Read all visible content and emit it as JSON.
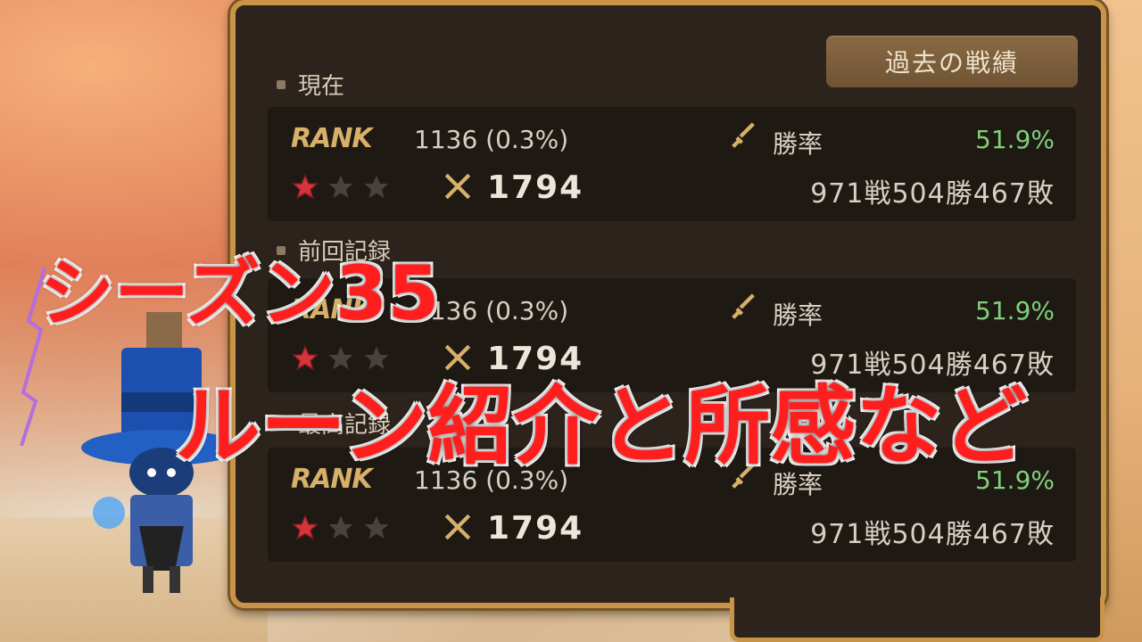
{
  "panel": {
    "history_button": "過去の戦績"
  },
  "sections": [
    {
      "label": "現在",
      "rank_label": "RANK",
      "rank_value": "1136 (0.3%)",
      "score": "1794",
      "winrate_label": "勝率",
      "winrate_value": "51.9%",
      "record": "971戦504勝467敗"
    },
    {
      "label": "前回記録",
      "rank_label": "RANK",
      "rank_value": "1136 (0.3%)",
      "score": "1794",
      "winrate_label": "勝率",
      "winrate_value": "51.9%",
      "record": "971戦504勝467敗"
    },
    {
      "label": "最高記録",
      "rank_label": "RANK",
      "rank_value": "1136 (0.3%)",
      "score": "1794",
      "winrate_label": "勝率",
      "winrate_value": "51.9%",
      "record": "971戦504勝467敗"
    }
  ],
  "overlay": {
    "line1": "シーズン35",
    "line2": "ルーン紹介と所感など"
  },
  "colors": {
    "panel_border": "#c89548",
    "winrate": "#7ed07a",
    "overlay_text": "#ff1e1e",
    "star_filled": "#d8323a"
  },
  "icons": [
    "star-filled-icon",
    "star-empty-icon",
    "crossed-swords-icon",
    "sword-icon"
  ]
}
